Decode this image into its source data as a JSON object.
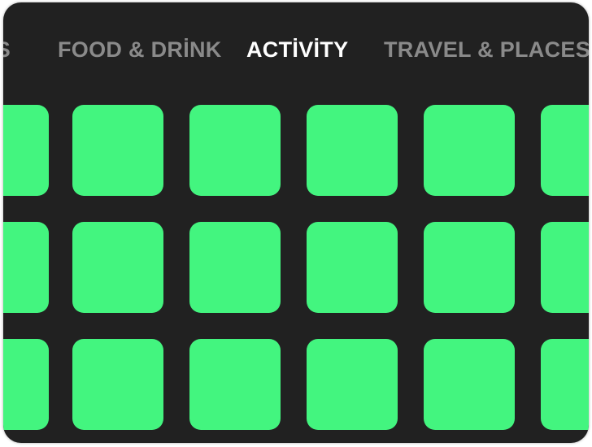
{
  "tabs": [
    {
      "label": "LS",
      "active": false
    },
    {
      "label": "FOOD & DRİNK",
      "active": false
    },
    {
      "label": "ACTİVİTY",
      "active": true
    },
    {
      "label": "TRAVEL & PLACES",
      "active": false
    }
  ],
  "colors": {
    "background": "#212121",
    "tile": "#43f57f",
    "tab_active": "#ffffff",
    "tab_inactive": "#8a8a8a"
  },
  "grid": {
    "rows": 3,
    "columns": 6,
    "tile_icon": "green-rounded-square-placeholder"
  }
}
